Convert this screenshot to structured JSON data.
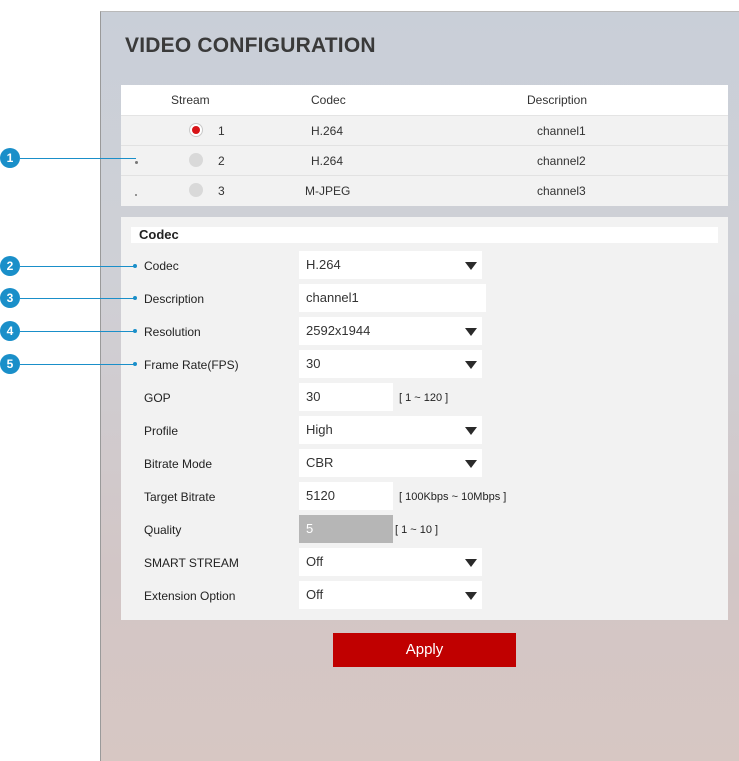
{
  "page": {
    "title": "VIDEO CONFIGURATION"
  },
  "stream_table": {
    "headers": {
      "stream": "Stream",
      "codec": "Codec",
      "description": "Description"
    },
    "rows": [
      {
        "stream": "1",
        "codec": "H.264",
        "description": "channel1",
        "selected": true
      },
      {
        "stream": "2",
        "codec": "H.264",
        "description": "channel2",
        "selected": false
      },
      {
        "stream": "3",
        "codec": "M-JPEG",
        "description": "channel3",
        "selected": false
      }
    ]
  },
  "codec_section": {
    "title": "Codec",
    "fields": {
      "codec": {
        "label": "Codec",
        "value": "H.264"
      },
      "description": {
        "label": "Description",
        "value": "channel1"
      },
      "resolution": {
        "label": "Resolution",
        "value": "2592x1944"
      },
      "frame_rate": {
        "label": "Frame Rate(FPS)",
        "value": "30"
      },
      "gop": {
        "label": "GOP",
        "value": "30",
        "range": "[ 1 ~ 120 ]"
      },
      "profile": {
        "label": "Profile",
        "value": "High"
      },
      "bitrate_mode": {
        "label": "Bitrate Mode",
        "value": "CBR"
      },
      "target_bitrate": {
        "label": "Target Bitrate",
        "value": "5120",
        "range": "[ 100Kbps ~ 10Mbps ]"
      },
      "quality": {
        "label": "Quality",
        "value": "5",
        "range": "[ 1 ~ 10 ]"
      },
      "smart_stream": {
        "label": "SMART STREAM",
        "value": "Off"
      },
      "extension_option": {
        "label": "Extension Option",
        "value": "Off"
      }
    }
  },
  "apply_label": "Apply",
  "callouts": [
    "1",
    "2",
    "3",
    "4",
    "5"
  ],
  "colors": {
    "accent_red": "#c00000",
    "radio_red": "#d81418",
    "callout_blue": "#1a8fc9"
  }
}
